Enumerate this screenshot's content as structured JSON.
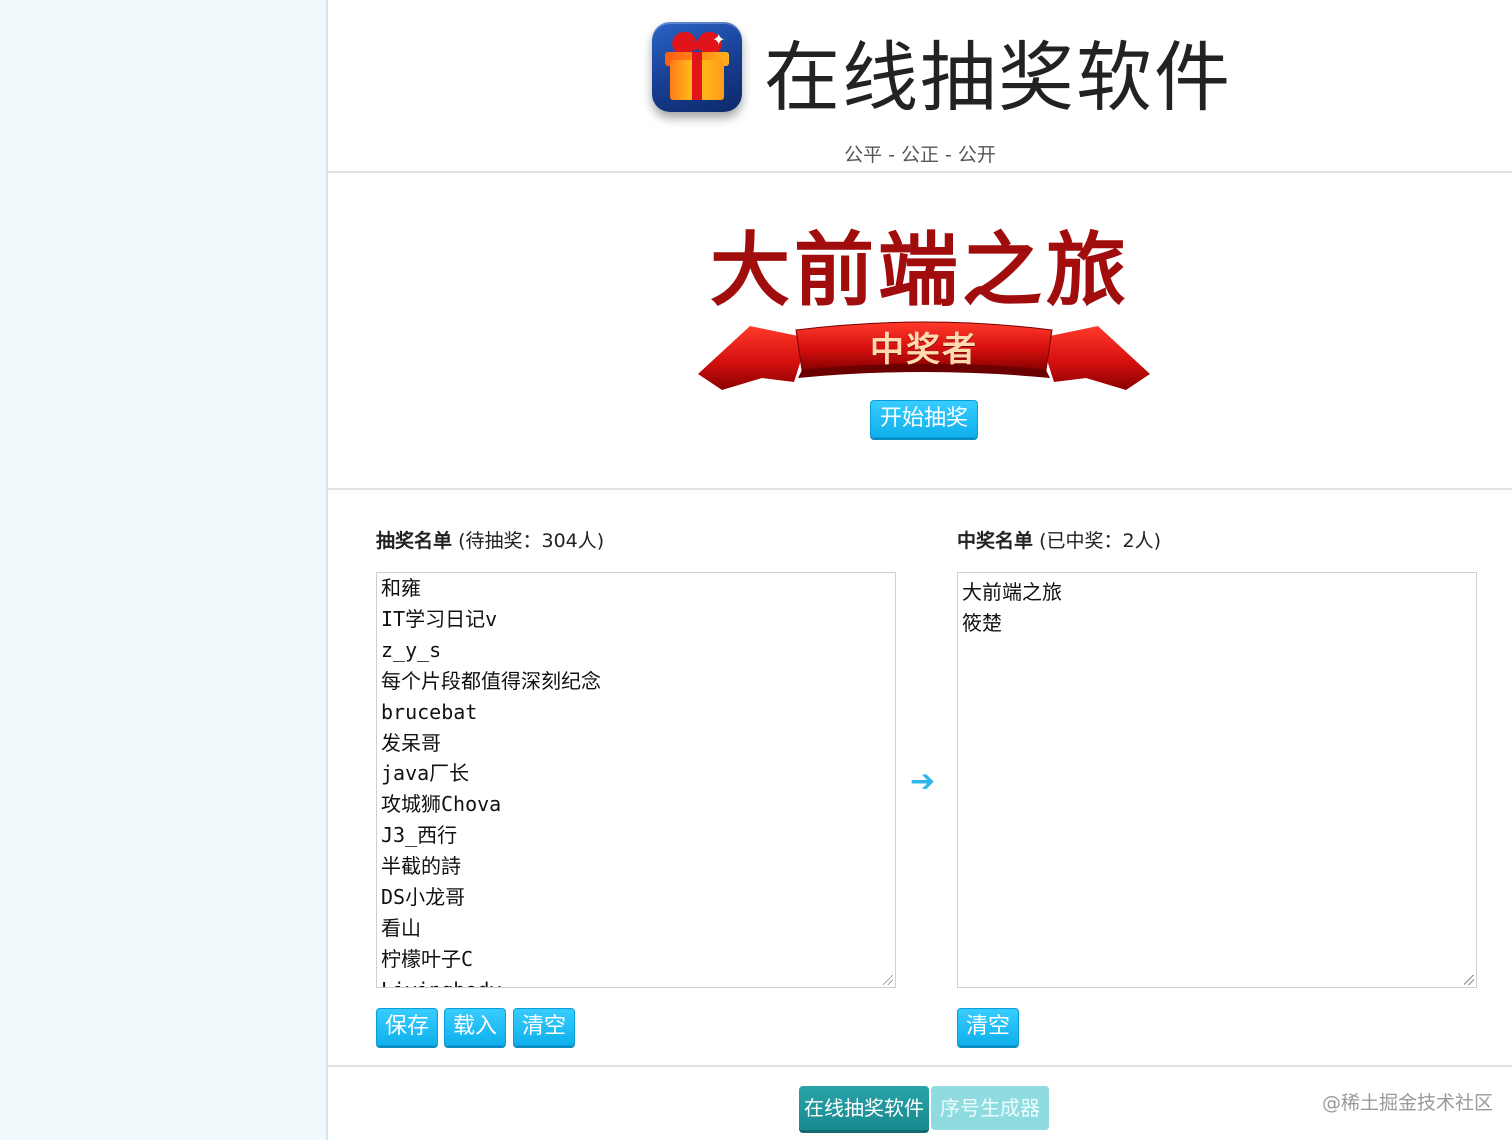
{
  "header": {
    "app_title": "在线抽奖软件",
    "slogan": "公平 - 公正 - 公开"
  },
  "draw": {
    "event_title": "大前端之旅",
    "banner_label": "中奖者",
    "start_button": "开始抽奖"
  },
  "pool_list": {
    "heading_bold": "抽奖名单",
    "heading_count": "(待抽奖：304人)",
    "entries": [
      "和雍",
      "IT学习日记v",
      "z_y_s",
      "每个片段都值得深刻纪念",
      "brucebat",
      "发呆哥",
      "java厂长",
      "攻城狮Chova",
      "J3_西行",
      "半截的詩",
      "DS小龙哥",
      "看山",
      "柠檬叶子C",
      "Livingbody"
    ],
    "buttons": {
      "save": "保存",
      "load": "载入",
      "clear": "清空"
    }
  },
  "winner_list": {
    "heading_bold": "中奖名单",
    "heading_count": "(已中奖：2人)",
    "entries": [
      "大前端之旅",
      "筱楚"
    ],
    "buttons": {
      "clear": "清空"
    }
  },
  "footer": {
    "nav_lottery": "在线抽奖软件",
    "nav_serial": "序号生成器",
    "watermark": "@稀土掘金技术社区"
  },
  "colors": {
    "accent_blue": "#10b0ec",
    "event_title_red": "#a10d0d",
    "nav_teal": "#188a90"
  },
  "icons": {
    "app_logo": "gift-box-icon",
    "transfer_arrow": "arrow-right-icon"
  }
}
